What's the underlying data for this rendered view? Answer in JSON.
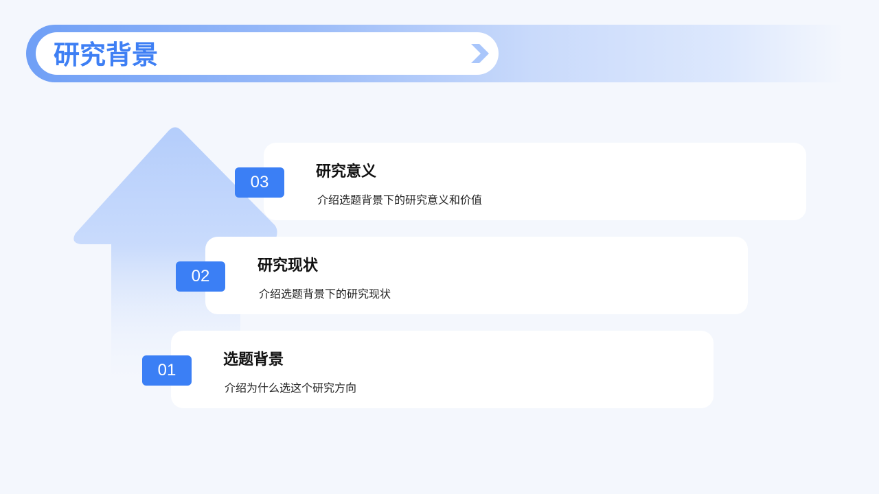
{
  "header": {
    "title": "研究背景",
    "icon": "chevron-right-icon"
  },
  "colors": {
    "background": "#f4f7fd",
    "accent": "#3b7ff5",
    "title": "#3e7ff4",
    "arrow": "#b9d0fb"
  },
  "items": [
    {
      "number": "03",
      "title": "研究意义",
      "description": "介绍选题背景下的研究意义和价值"
    },
    {
      "number": "02",
      "title": "研究现状",
      "description": "介绍选题背景下的研究现状"
    },
    {
      "number": "01",
      "title": "选题背景",
      "description": "介绍为什么选这个研究方向"
    }
  ]
}
